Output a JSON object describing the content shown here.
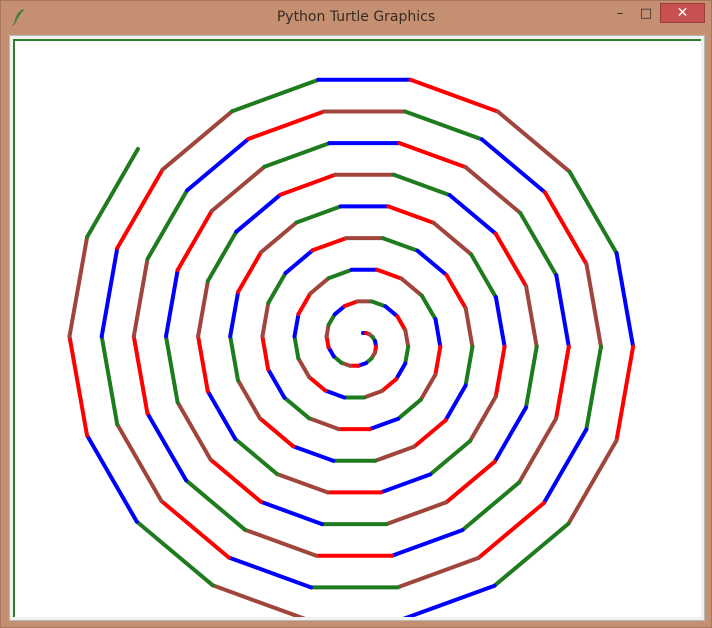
{
  "window": {
    "title": "Python Turtle Graphics",
    "icons": {
      "app": "feather-icon",
      "minimize": "minimize-icon",
      "maximize": "maximize-icon",
      "close": "close-icon"
    },
    "glyphs": {
      "minimize": "–",
      "maximize": "□",
      "close": "✕"
    }
  },
  "canvas": {
    "background": "#ffffff",
    "pen_colors": [
      "#0000ff",
      "#ff0000",
      "#a0453c",
      "#1e7b1e"
    ]
  }
}
